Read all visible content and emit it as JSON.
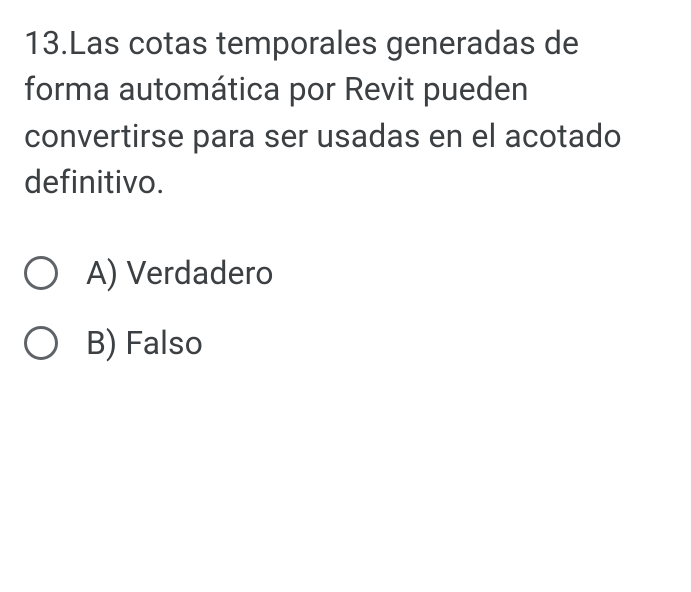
{
  "question": {
    "text": "13.Las cotas temporales generadas de forma automática por Revit pueden convertirse para ser usadas en el acotado definitivo."
  },
  "options": [
    {
      "label": "A) Verdadero"
    },
    {
      "label": "B) Falso"
    }
  ]
}
